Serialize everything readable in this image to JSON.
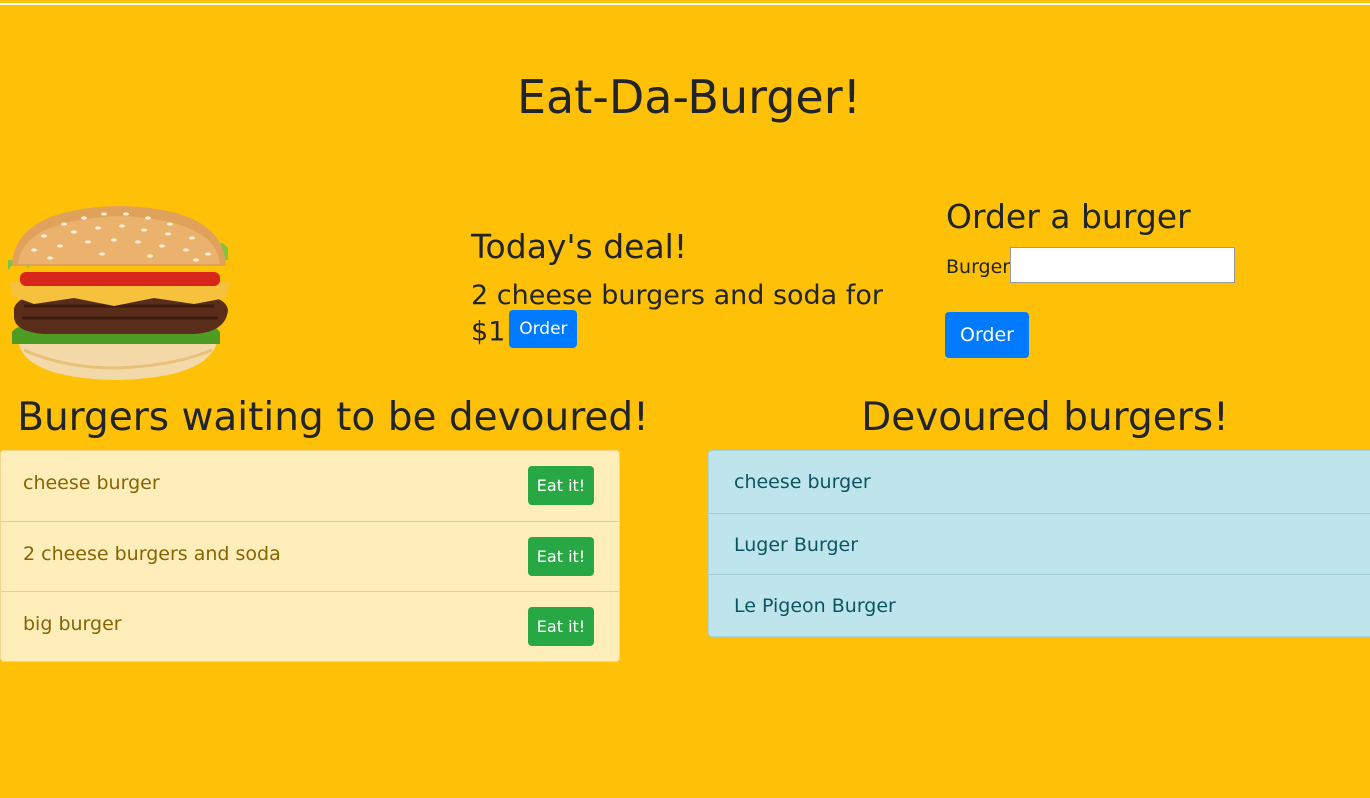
{
  "header": {
    "title": "Eat-Da-Burger!"
  },
  "hero": {
    "image_icon": "burger-illustration"
  },
  "deal": {
    "heading": "Today's deal!",
    "text": "2 cheese burgers and soda for $1",
    "order_label": "Order"
  },
  "order_form": {
    "heading": "Order a burger",
    "burger_label": "Burger",
    "burger_value": "",
    "submit_label": "Order"
  },
  "waiting": {
    "heading": "Burgers waiting to be devoured!",
    "button_label": "Eat it!",
    "items": [
      {
        "name": "cheese burger"
      },
      {
        "name": "2 cheese burgers and soda"
      },
      {
        "name": "big burger"
      }
    ]
  },
  "devoured": {
    "heading": "Devoured burgers!",
    "items": [
      {
        "name": "cheese burger"
      },
      {
        "name": "Luger Burger"
      },
      {
        "name": "Le Pigeon Burger"
      }
    ]
  },
  "colors": {
    "background": "#ffc107",
    "primary": "#007bff",
    "success": "#28a745",
    "waiting_bg": "#ffeeba",
    "devoured_bg": "#bee5eb"
  }
}
